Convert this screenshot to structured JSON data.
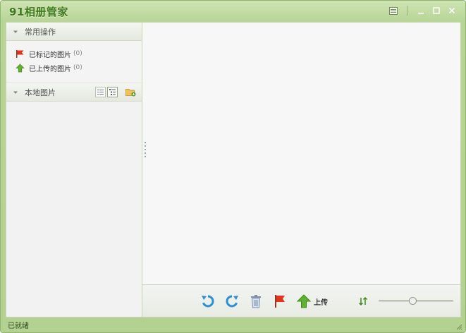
{
  "app": {
    "title": "91相册管家"
  },
  "sidebar": {
    "common": {
      "header": "常用操作",
      "items": [
        {
          "label": "已标记的图片",
          "count": "(0)",
          "icon": "red-flag-icon"
        },
        {
          "label": "已上传的图片",
          "count": "(0)",
          "icon": "green-up-arrow-icon"
        }
      ]
    },
    "local": {
      "header": "本地图片"
    }
  },
  "toolbar": {
    "upload_label": "上传",
    "zoom_level": 0.45
  },
  "status": {
    "text": "已就绪"
  },
  "colors": {
    "accent_green": "#5aa02c",
    "title_green": "#3f7a1a",
    "flag_red": "#e0341c",
    "rotate_blue": "#2c8fd6"
  }
}
